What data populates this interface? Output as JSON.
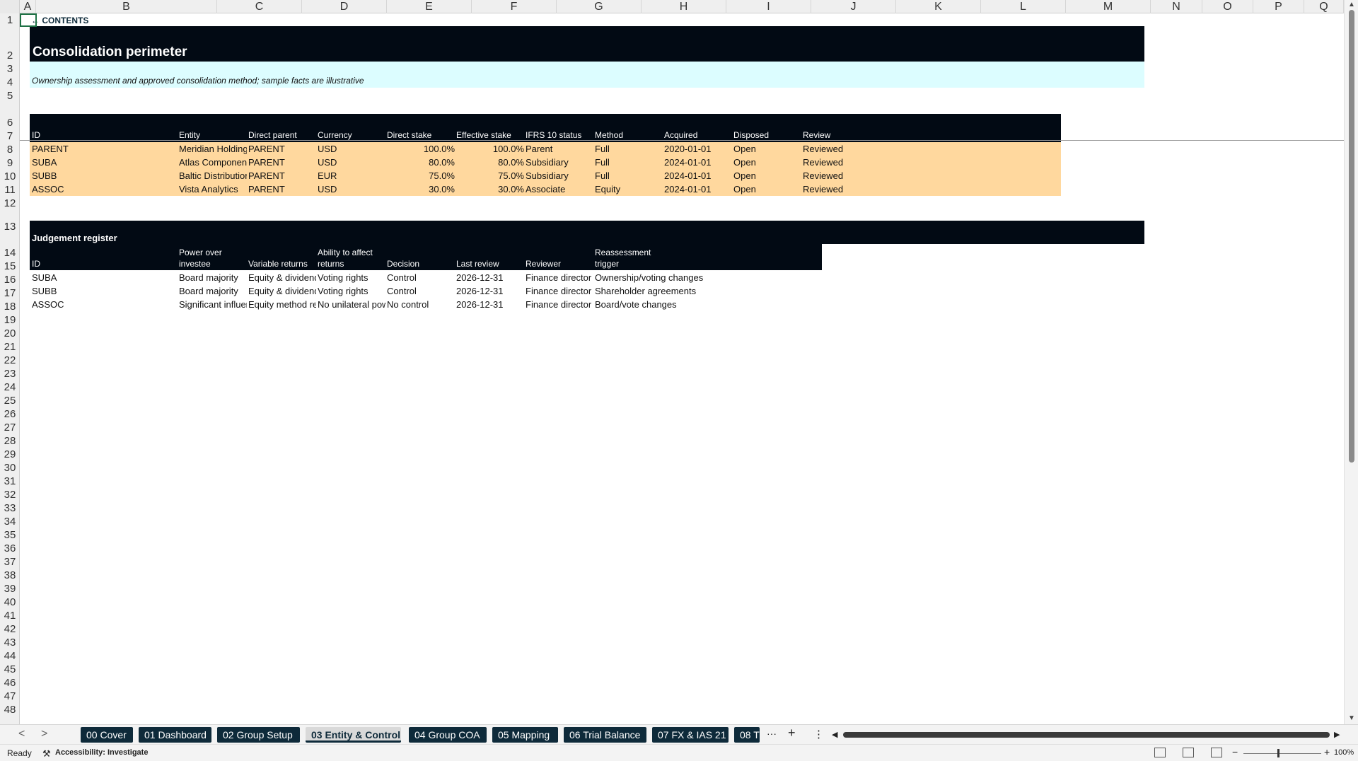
{
  "columns": [
    "A",
    "B",
    "C",
    "D",
    "E",
    "F",
    "G",
    "H",
    "I",
    "J",
    "K",
    "L",
    "M",
    "N",
    "O",
    "P",
    "Q"
  ],
  "rows": [
    "1",
    "2",
    "3",
    "4",
    "5",
    "6",
    "7",
    "8",
    "9",
    "10",
    "11",
    "12",
    "13",
    "14",
    "15",
    "16",
    "17",
    "18",
    "19",
    "20",
    "21",
    "22",
    "23",
    "24",
    "25",
    "26",
    "27",
    "28",
    "29",
    "30",
    "31",
    "32",
    "33",
    "34",
    "35",
    "36",
    "37",
    "38",
    "39",
    "40",
    "41",
    "42",
    "43",
    "44",
    "45",
    "46",
    "47",
    "48"
  ],
  "sheet": {
    "contents_link": "← CONTENTS",
    "title": "Consolidation perimeter",
    "subtitle": "Ownership assessment and approved consolidation method; sample facts are illustrative",
    "entity_table": {
      "headers": [
        "ID",
        "Entity",
        "Direct parent",
        "Currency",
        "Direct stake",
        "Effective stake",
        "IFRS 10 status",
        "Method",
        "Acquired",
        "Disposed",
        "Review"
      ],
      "rows": [
        [
          "PARENT",
          "Meridian Holdings",
          "PARENT",
          "USD",
          "100.0%",
          "100.0%",
          "Parent",
          "Full",
          "2020-01-01",
          "Open",
          "Reviewed"
        ],
        [
          "SUBA",
          "Atlas Components",
          "PARENT",
          "USD",
          "80.0%",
          "80.0%",
          "Subsidiary",
          "Full",
          "2024-01-01",
          "Open",
          "Reviewed"
        ],
        [
          "SUBB",
          "Baltic Distribution",
          "PARENT",
          "EUR",
          "75.0%",
          "75.0%",
          "Subsidiary",
          "Full",
          "2024-01-01",
          "Open",
          "Reviewed"
        ],
        [
          "ASSOC",
          "Vista Analytics",
          "PARENT",
          "USD",
          "30.0%",
          "30.0%",
          "Associate",
          "Equity",
          "2024-01-01",
          "Open",
          "Reviewed"
        ]
      ]
    },
    "judgement": {
      "title": "Judgement register",
      "headers": [
        {
          "l1": "",
          "l2": "ID"
        },
        {
          "l1": "Power over",
          "l2": "investee"
        },
        {
          "l1": "",
          "l2": "Variable returns"
        },
        {
          "l1": "Ability to affect",
          "l2": "returns"
        },
        {
          "l1": "",
          "l2": "Decision"
        },
        {
          "l1": "",
          "l2": "Last review"
        },
        {
          "l1": "",
          "l2": "Reviewer"
        },
        {
          "l1": "Reassessment",
          "l2": "trigger"
        }
      ],
      "rows": [
        [
          "SUBA",
          "Board majority",
          "Equity & dividends",
          "Voting rights",
          "Control",
          "2026-12-31",
          "Finance director",
          "Ownership/voting changes"
        ],
        [
          "SUBB",
          "Board majority",
          "Equity & dividends",
          "Voting rights",
          "Control",
          "2026-12-31",
          "Finance director",
          "Shareholder agreements"
        ],
        [
          "ASSOC",
          "Significant influence",
          "Equity method retur",
          "No unilateral power",
          "No control",
          "2026-12-31",
          "Finance director",
          "Board/vote changes"
        ]
      ]
    }
  },
  "tabs": [
    "00 Cover",
    "01 Dashboard",
    "02 Group Setup",
    "03 Entity & Control",
    "04 Group COA",
    "05 Mapping",
    "06 Trial Balance",
    "07 FX & IAS 21",
    "08 T"
  ],
  "active_tab": "03 Entity & Control",
  "tab_controls": {
    "more": "···",
    "add": "+",
    "menu": "⋮",
    "prev": "<",
    "next": ">"
  },
  "status": {
    "ready": "Ready",
    "accessibility": "Accessibility: Investigate",
    "zoom": "100%",
    "zoom_minus": "−",
    "zoom_plus": "+"
  },
  "colors": {
    "header_dark": "#020a14",
    "band_cyan": "#dcfdff",
    "band_orange": "#ffd89e",
    "tab_dark": "#0e2a3a"
  }
}
